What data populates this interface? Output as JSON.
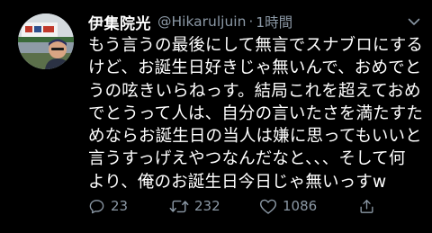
{
  "tweet": {
    "display_name": "伊集院光",
    "handle": "@Hikaruljuin",
    "separator": "·",
    "time": "1時間",
    "lines": [
      "もう言うの最後にして無言でスナブロにする",
      "けど、お誕生日好きじゃ無いんで、おめでと",
      "うの呟きいらねっす。結局これを超えておめ",
      "でとうって人は、自分の言いたさを満たすた",
      "めならお誕生日の当人は嫌に思ってもいいと",
      "言うすっげえやつなんだなと、、、そして何",
      "より、俺のお誕生日今日じゃ無いっすw"
    ],
    "actions": {
      "reply_count": "23",
      "retweet_count": "232",
      "like_count": "1086"
    }
  },
  "icons": {
    "avatar": "profile-photo",
    "menu": "chevron-down-icon",
    "reply": "reply-icon",
    "retweet": "retweet-icon",
    "like": "heart-icon",
    "share": "share-icon"
  },
  "colors": {
    "background": "#000000",
    "text": "#ffffff",
    "secondary": "#8b98a5"
  }
}
